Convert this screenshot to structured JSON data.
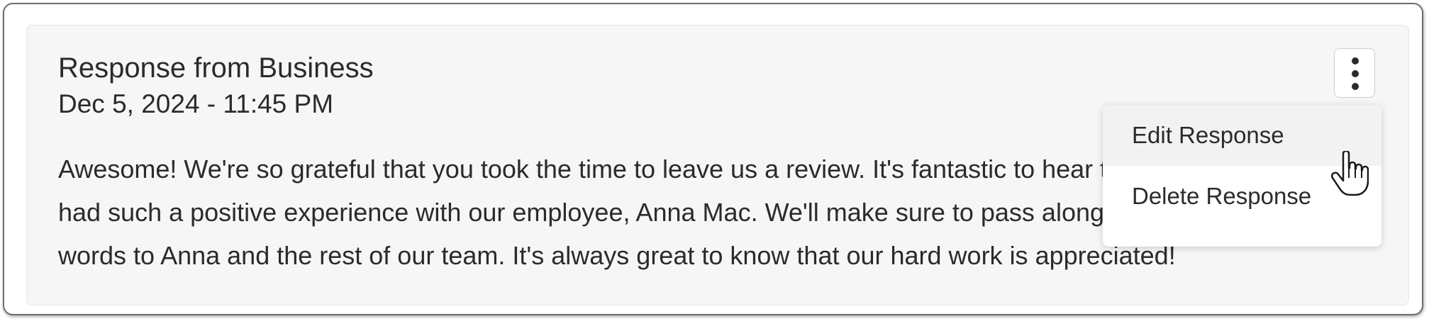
{
  "response": {
    "title": "Response from Business",
    "timestamp": "Dec 5, 2024 - 11:45 PM",
    "body_lines": [
      "Awesome! We're so grateful that you took the time to leave us a review. It's fantastic to hear that you",
      "had such a positive experience with our employee, Anna Mac. We'll make sure to pass along your kind",
      "words to Anna and the rest of our team. It's always great to know that our hard work is appreciated!"
    ]
  },
  "menu": {
    "icon": "more-vertical-icon",
    "items": [
      {
        "label": "Edit Response",
        "state": "hovered"
      },
      {
        "label": "Delete Response",
        "state": "default"
      }
    ]
  },
  "colors": {
    "card_background": "#f6f6f6",
    "text": "#2b2b2b",
    "menu_hover": "#f2f2f2"
  },
  "cursor": "hand-pointer-icon"
}
